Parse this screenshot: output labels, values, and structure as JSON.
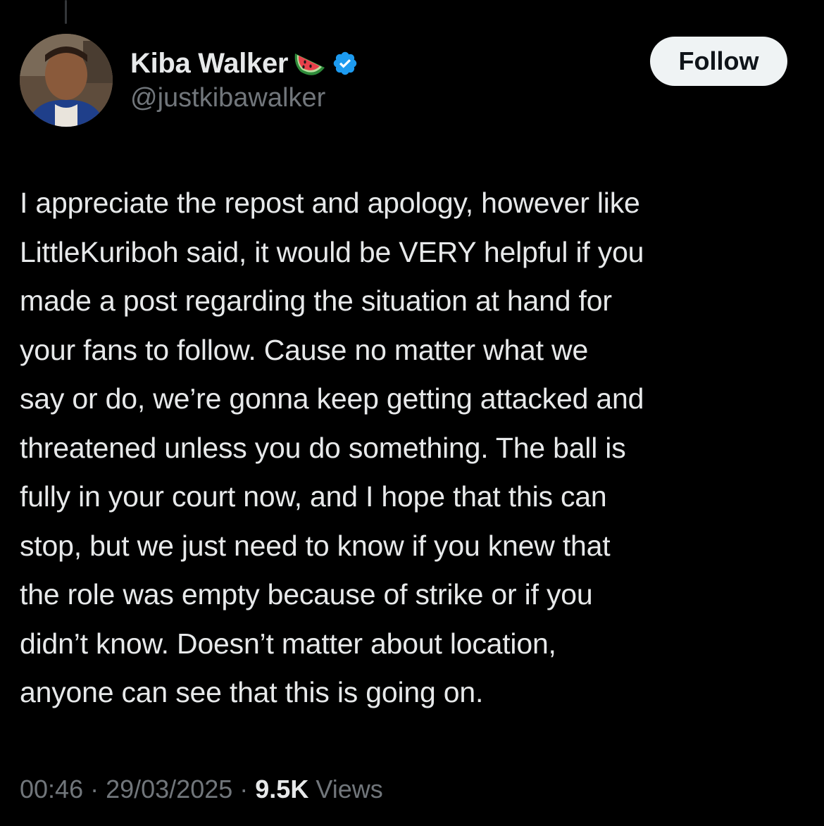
{
  "tweet": {
    "author": {
      "display_name": "Kiba Walker",
      "handle": "@justkibawalker",
      "name_emoji": "watermelon-icon",
      "verified_icon": "verified-badge-icon",
      "verified_color": "#1d9bf0"
    },
    "follow_label": "Follow",
    "text": "I appreciate the repost and apology, however like\nLittleKuriboh said, it would be VERY helpful if you\nmade a post regarding the situation at hand for\nyour fans to follow. Cause no matter what we\nsay or do, we’re gonna keep getting attacked and\nthreatened unless you do something. The ball is\nfully in your court now, and I hope that this can\nstop, but we just need to know if you knew that\nthe role was empty because of strike or if you\ndidn’t know. Doesn’t matter about location,\nanyone can see that this is going on.",
    "time": "00:46",
    "date": "29/03/2025",
    "separator": "·",
    "views_count": "9.5K",
    "views_label": "Views"
  },
  "colors": {
    "background": "#000000",
    "primary_text": "#e7e9ea",
    "secondary_text": "#71767b",
    "follow_button_bg": "#eff3f4"
  }
}
